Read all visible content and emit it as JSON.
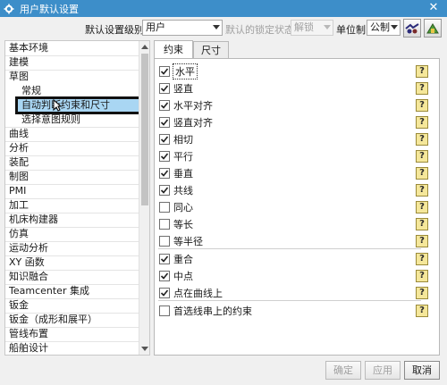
{
  "window": {
    "title": "用户默认设置",
    "close_symbol": "✕"
  },
  "toolbar": {
    "level_label": "默认设置级别",
    "level_value": "用户",
    "lock_label": "默认的锁定状态",
    "lock_value": "解锁",
    "unit_label": "单位制",
    "unit_value": "公制",
    "icon1": "customer-defaults-icon",
    "icon2": "manager-icon"
  },
  "sidebar": {
    "items": [
      "基本环境",
      "建模",
      "草图",
      "常规",
      "自动判断约束和尺寸",
      "选择意图规则",
      "曲线",
      "分析",
      "装配",
      "制图",
      "PMI",
      "加工",
      "机床构建器",
      "仿真",
      "运动分析",
      "XY 函数",
      "知识融合",
      "Teamcenter 集成",
      "钣金",
      "钣金（成形和展平）",
      "管线布置",
      "船舶设计"
    ],
    "selected_index": 4
  },
  "tabs": [
    "约束",
    "尺寸"
  ],
  "constraints": [
    {
      "label": "水平",
      "checked": true
    },
    {
      "label": "竖直",
      "checked": true
    },
    {
      "label": "水平对齐",
      "checked": true
    },
    {
      "label": "竖直对齐",
      "checked": true
    },
    {
      "label": "相切",
      "checked": true
    },
    {
      "label": "平行",
      "checked": true
    },
    {
      "label": "垂直",
      "checked": true
    },
    {
      "label": "共线",
      "checked": true
    },
    {
      "label": "同心",
      "checked": false
    },
    {
      "label": "等长",
      "checked": false
    },
    {
      "label": "等半径",
      "checked": false
    },
    {
      "label": "重合",
      "checked": true
    },
    {
      "label": "中点",
      "checked": true
    },
    {
      "label": "点在曲线上",
      "checked": true
    },
    {
      "label": "首选线串上的约束",
      "checked": false
    }
  ],
  "help_symbol": "?",
  "buttons": {
    "ok": "确定",
    "apply": "应用",
    "cancel": "取消"
  },
  "colors": {
    "titlebar": "#3d8ec9",
    "selected_row": "#a9d6f3"
  }
}
